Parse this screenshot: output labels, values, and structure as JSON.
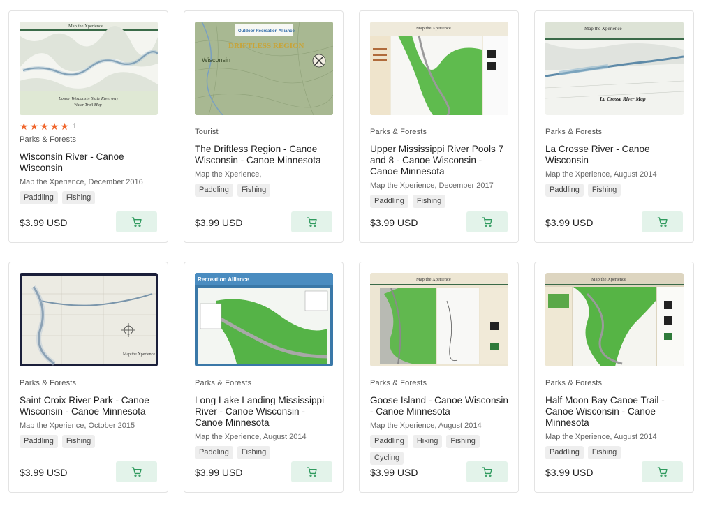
{
  "accent_color": "#2f9a5e",
  "star_color": "#f0642a",
  "cart_icon": "shopping-cart-icon",
  "cards": [
    {
      "rating_stars": 5,
      "rating_count": "1",
      "category": "Parks & Forests",
      "title": "Wisconsin River - Canoe Wisconsin",
      "byline": "Map the Xperience, December 2016",
      "tags": [
        "Paddling",
        "Fishing"
      ],
      "price": "$3.99 USD",
      "thumb_caption": [
        "Lower Wisconsin State Riverway",
        "Water Trail Map"
      ],
      "thumb_header": "Map the Xperience"
    },
    {
      "category": "Tourist",
      "title": "The Driftless Region - Canoe Wisconsin - Canoe Minnesota",
      "byline": "Map the Xperience,",
      "tags": [
        "Paddling",
        "Fishing"
      ],
      "price": "$3.99 USD",
      "thumb_caption": [
        "DRIFTLESS REGION",
        "Wisconsin",
        "Outdoor Recreation Alliance"
      ]
    },
    {
      "category": "Parks & Forests",
      "title": "Upper Mississippi River Pools 7 and 8 - Canoe Wisconsin - Canoe Minnesota",
      "byline": "Map the Xperience, December 2017",
      "tags": [
        "Paddling",
        "Fishing"
      ],
      "price": "$3.99 USD",
      "thumb_caption": [
        "Map the Xperience"
      ]
    },
    {
      "category": "Parks & Forests",
      "title": "La Crosse River - Canoe Wisconsin",
      "byline": "Map the Xperience, August 2014",
      "tags": [
        "Paddling",
        "Fishing"
      ],
      "price": "$3.99 USD",
      "thumb_caption": [
        "La Crosse River Map",
        "Map the Xperience"
      ]
    },
    {
      "category": "Parks & Forests",
      "title": "Saint Croix River Park - Canoe Wisconsin - Canoe Minnesota",
      "byline": "Map the Xperience, October 2015",
      "tags": [
        "Paddling",
        "Fishing"
      ],
      "price": "$3.99 USD",
      "thumb_caption": [
        "Map the Xperience"
      ]
    },
    {
      "category": "Parks & Forests",
      "title": "Long Lake Landing Mississippi River - Canoe Wisconsin - Canoe Minnesota",
      "byline": "Map the Xperience, August 2014",
      "tags": [
        "Paddling",
        "Fishing"
      ],
      "price": "$3.99 USD",
      "thumb_caption": [
        "Recreation Alliance"
      ]
    },
    {
      "category": "Parks & Forests",
      "title": "Goose Island - Canoe Wisconsin - Canoe Minnesota",
      "byline": "Map the Xperience, August 2014",
      "tags": [
        "Paddling",
        "Hiking",
        "Fishing",
        "Cycling"
      ],
      "price": "$3.99 USD",
      "thumb_caption": [
        "Map the Xperience"
      ]
    },
    {
      "category": "Parks & Forests",
      "title": "Half Moon Bay Canoe Trail - Canoe Wisconsin - Canoe Minnesota",
      "byline": "Map the Xperience, August 2014",
      "tags": [
        "Paddling",
        "Fishing"
      ],
      "price": "$3.99 USD",
      "thumb_caption": [
        "Map the Xperience"
      ]
    }
  ]
}
